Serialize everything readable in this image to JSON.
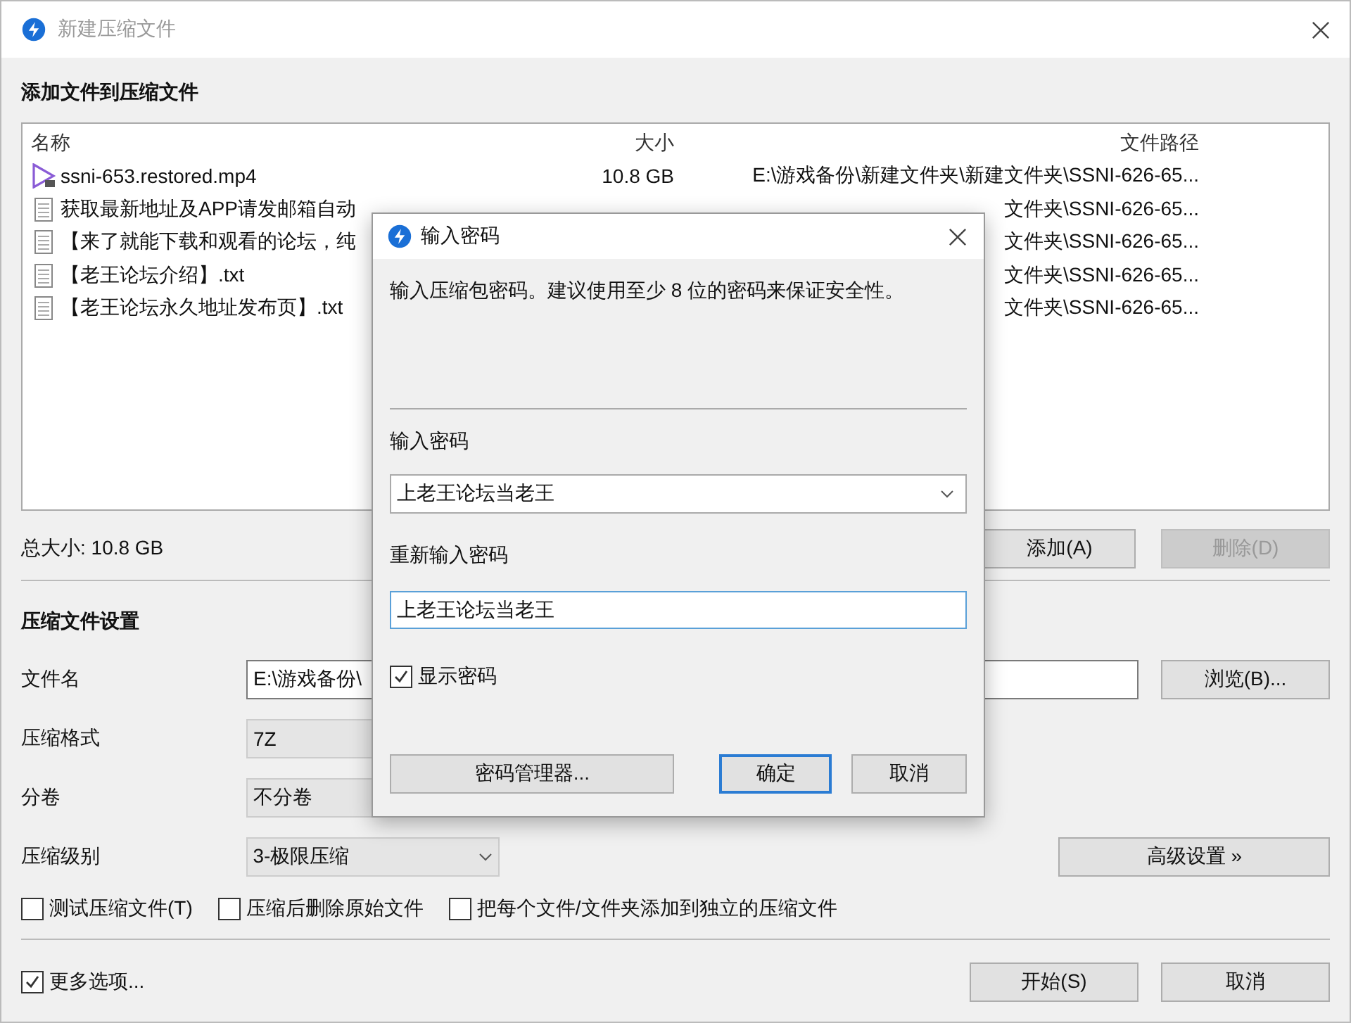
{
  "window": {
    "title": "新建压缩文件"
  },
  "add_section": {
    "heading": "添加文件到压缩文件",
    "file_list": {
      "columns": [
        "名称",
        "大小",
        "文件路径"
      ],
      "rows": [
        {
          "kind": "video",
          "name": "ssni-653.restored.mp4",
          "size": "10.8 GB",
          "path": "E:\\游戏备份\\新建文件夹\\新建文件夹\\SSNI-626-65..."
        },
        {
          "kind": "text",
          "name": "获取最新地址及APP请发邮箱自动",
          "path": "文件夹\\SSNI-626-65..."
        },
        {
          "kind": "text",
          "name": "【来了就能下载和观看的论坛，纯",
          "path": "文件夹\\SSNI-626-65..."
        },
        {
          "kind": "text",
          "name": "【老王论坛介绍】.txt",
          "path": "文件夹\\SSNI-626-65..."
        },
        {
          "kind": "text",
          "name": "【老王论坛永久地址发布页】.txt",
          "path": "文件夹\\SSNI-626-65..."
        }
      ]
    },
    "total_size": "总大小: 10.8 GB",
    "buttons": [
      {
        "label": "添加(A)",
        "disabled": false
      },
      {
        "label": "删除(D)",
        "disabled": true
      }
    ]
  },
  "settings": {
    "heading": "压缩文件设置",
    "fields": [
      {
        "label": "文件名",
        "kind": "text",
        "value": "E:\\游戏备份\\"
      },
      {
        "label": "压缩格式",
        "kind": "select",
        "value": "7Z"
      },
      {
        "label": "分卷",
        "kind": "select",
        "value": "不分卷"
      },
      {
        "label": "压缩级别",
        "kind": "dropdown",
        "value": "3-极限压缩"
      }
    ],
    "browse_button": "浏览(B)...",
    "advanced_button": "高级设置 »",
    "options": [
      {
        "label": "测试压缩文件(T)",
        "checked": false
      },
      {
        "label": "压缩后删除原始文件",
        "checked": false
      },
      {
        "label": "把每个文件/文件夹添加到独立的压缩文件",
        "checked": false
      }
    ]
  },
  "footer": {
    "more_options": {
      "label": "更多选项...",
      "checked": true
    },
    "buttons": [
      "开始(S)",
      "取消"
    ]
  },
  "dialog": {
    "title": "输入密码",
    "description": "输入压缩包密码。建议使用至少 8 位的密码来保证安全性。",
    "password_label": "输入密码",
    "password": "上老王论坛当老王",
    "confirm_label": "重新输入密码",
    "confirm_password": "上老王论坛当老王",
    "show_password": {
      "label": "显示密码",
      "checked": true
    },
    "buttons": [
      {
        "label": "密码管理器...",
        "default": false
      },
      {
        "label": "确定",
        "default": true
      },
      {
        "label": "取消",
        "default": false
      }
    ]
  }
}
